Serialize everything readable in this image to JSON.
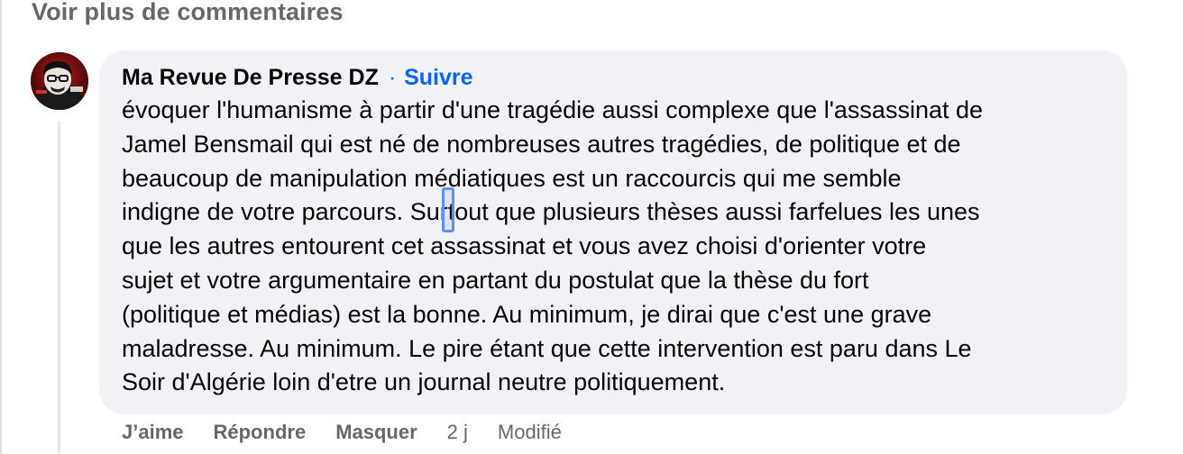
{
  "header": {
    "view_more_comments": "Voir plus de commentaires"
  },
  "comment": {
    "author": "Ma Revue De Presse DZ",
    "separator": "·",
    "follow_label": "Suivre",
    "body_lines": [
      "évoquer l'humanisme à partir d'une tragédie aussi complexe que l'assassinat de",
      "Jamel Bensmail qui est né de nombreuses autres tragédies, de politique et de",
      "beaucoup de manipulation médiatiques est un raccourcis qui me semble",
      "indigne de votre parcours. Surtout que plusieurs thèses aussi farfelues les unes",
      "que les autres entourent cet assassinat et vous avez choisi d'orienter votre",
      "sujet et votre argumentaire en partant du postulat que la thèse du fort",
      "(politique et médias) est la bonne. Au minimum, je dirai que c'est une grave",
      "maladresse. Au minimum. Le pire étant que cette intervention est paru dans Le",
      "Soir d'Algérie loin d'etre un journal neutre politiquement."
    ],
    "actions": {
      "like": "J’aime",
      "reply": "Répondre",
      "hide": "Masquer",
      "timestamp": "2 j",
      "edited": "Modifié"
    }
  },
  "colors": {
    "bubble_bg": "#f0f2f5",
    "link_blue": "#0866ff",
    "meta_gray": "#65676b",
    "text": "#050505"
  },
  "icons": {
    "avatar": "profile-avatar-icon"
  }
}
